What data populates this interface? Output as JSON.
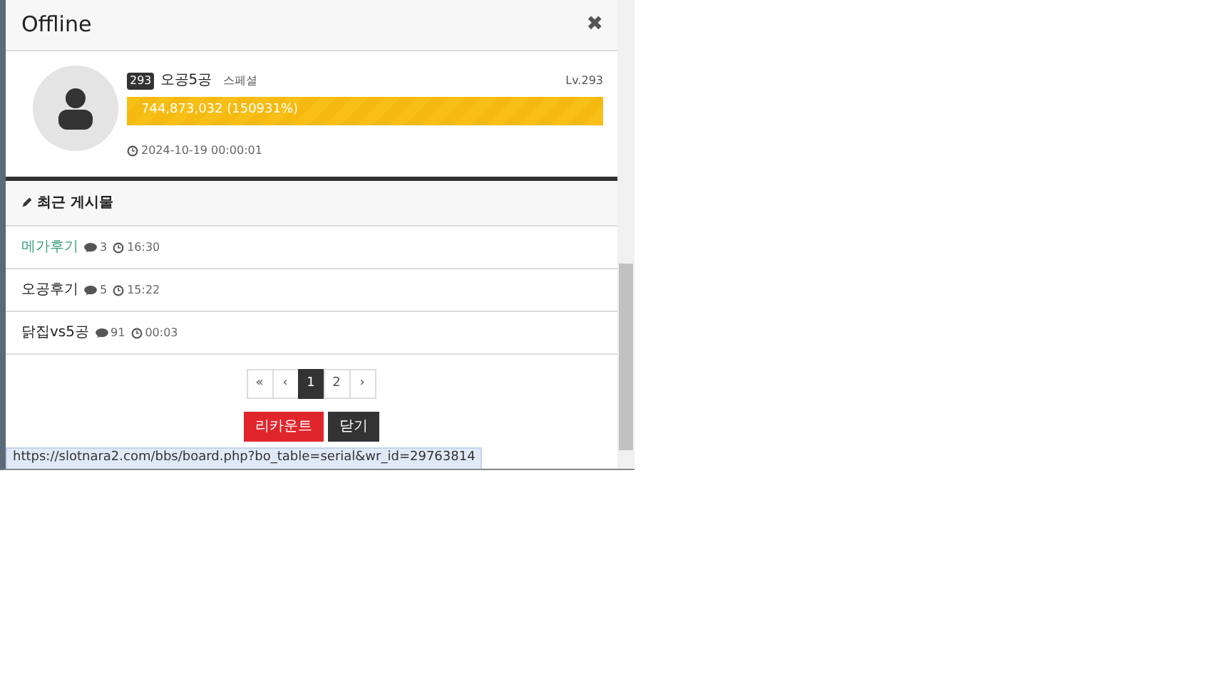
{
  "window": {
    "title": "Offline",
    "close": "✖"
  },
  "profile": {
    "badge": "293",
    "name": "오공5공",
    "rank": "스페셜",
    "level_label": "Lv.293",
    "exp": {
      "text": "744,873,032 (150931%)",
      "level": 1.0
    },
    "last_login": "2024-10-19 00:00:01"
  },
  "recent_posts": {
    "title": "최근 게시물",
    "items": [
      {
        "title": "메가후기",
        "comments": "3",
        "time": "16:30",
        "visited": true
      },
      {
        "title": "오공후기",
        "comments": "5",
        "time": "15:22",
        "visited": false
      },
      {
        "title": "닭집vs5공",
        "comments": "91",
        "time": "00:03",
        "visited": false
      }
    ]
  },
  "pagination": [
    {
      "label": "«",
      "selected": false
    },
    {
      "label": "‹",
      "selected": false
    },
    {
      "label": "1",
      "selected": true
    },
    {
      "label": "2",
      "selected": false
    },
    {
      "label": "›",
      "selected": false
    }
  ],
  "buttons": [
    {
      "label": "리카운트",
      "kind": "danger"
    },
    {
      "label": "닫기",
      "kind": "dark"
    }
  ],
  "status_url": "https://slotnara2.com/bbs/board.php?bo_table=serial&wr_id=29763814"
}
